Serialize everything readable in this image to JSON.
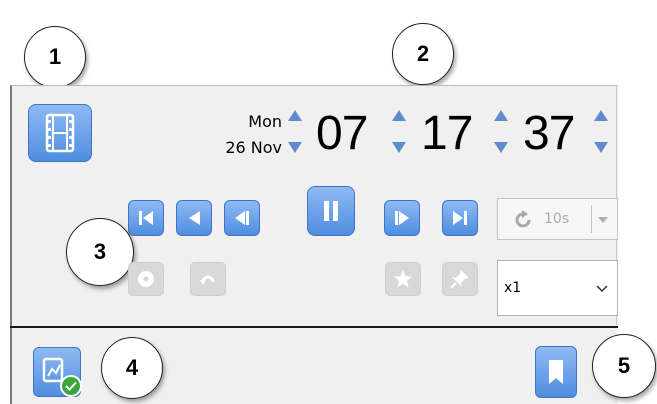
{
  "callouts": [
    "1",
    "2",
    "3",
    "4",
    "5"
  ],
  "date": {
    "weekday": "Mon",
    "day_month": "26 Nov"
  },
  "time": {
    "hours": "07",
    "minutes": "17",
    "seconds": "37"
  },
  "skip": {
    "label": "10s"
  },
  "speed": {
    "value": "x1"
  },
  "colors": {
    "accent_blue": "#4f8de0",
    "panel_bg": "#f0f0f0",
    "disabled_grey": "#d8d8d8",
    "status_green": "#3aa63a"
  }
}
